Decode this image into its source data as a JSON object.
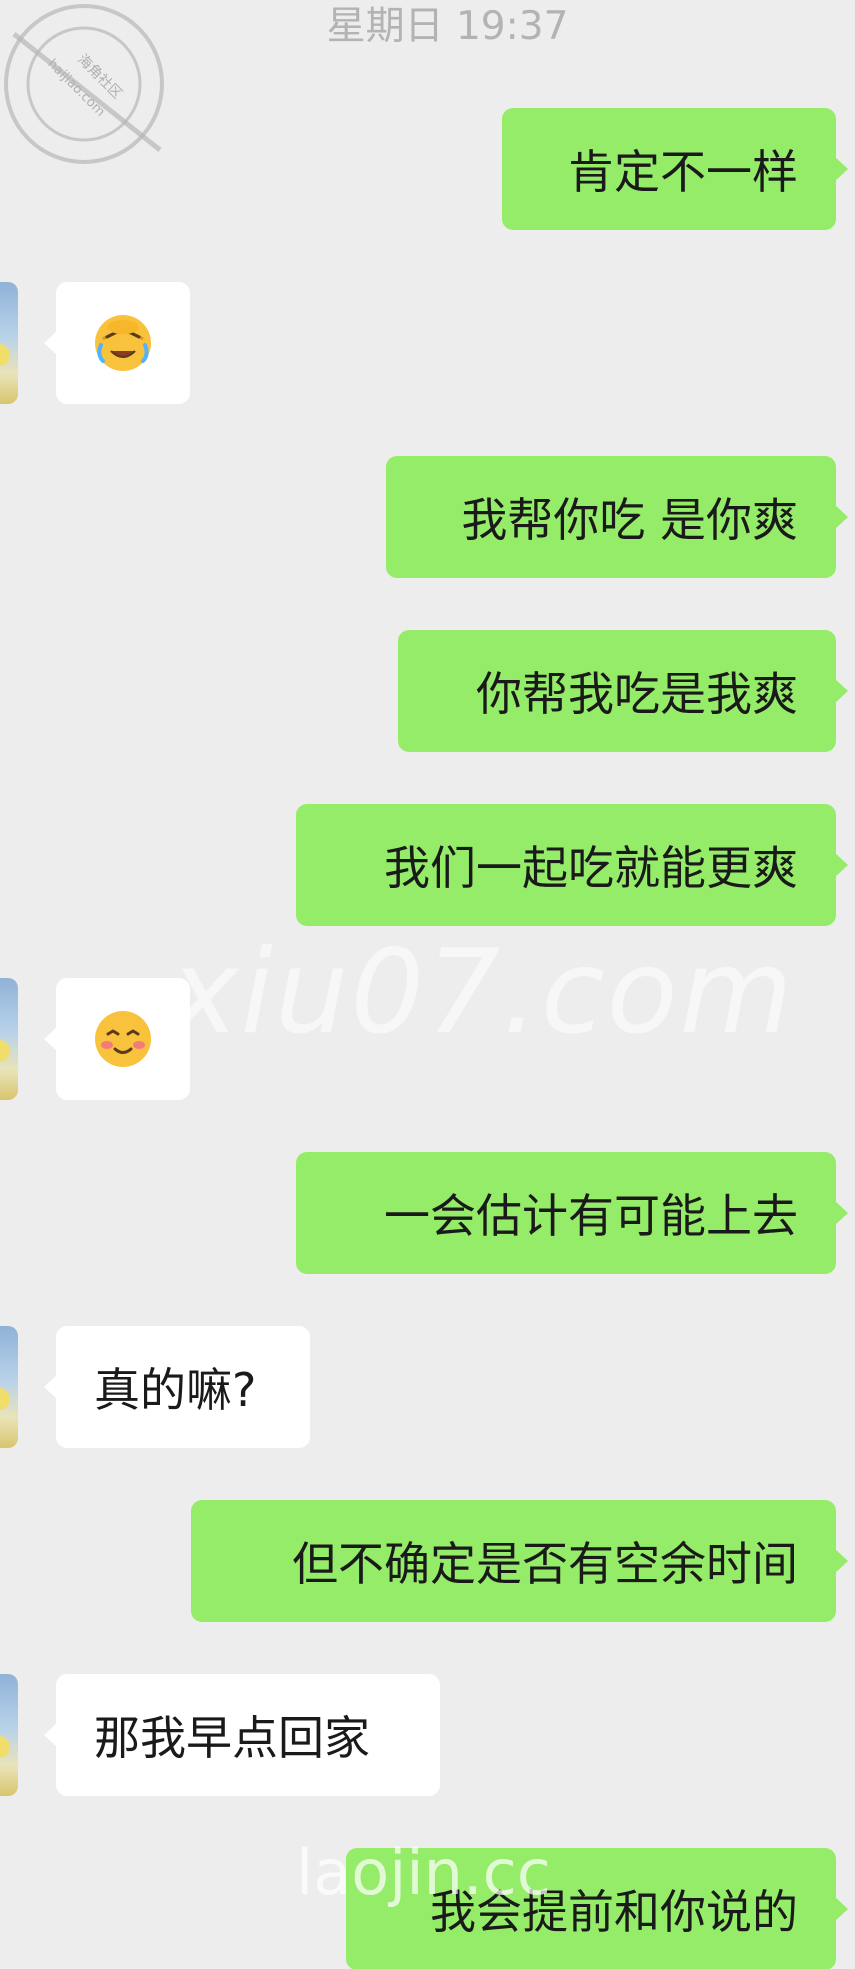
{
  "chat": {
    "timestamp": "星期日 19:37",
    "messages": [
      {
        "side": "out",
        "type": "text",
        "text": "肯定不一样"
      },
      {
        "side": "in",
        "type": "emoji",
        "emoji": "face-palm-tears-emoji"
      },
      {
        "side": "out",
        "type": "text",
        "text": "我帮你吃 是你爽"
      },
      {
        "side": "out",
        "type": "text",
        "text": "你帮我吃是我爽"
      },
      {
        "side": "out",
        "type": "text",
        "text": "我们一起吃就能更爽"
      },
      {
        "side": "in",
        "type": "emoji",
        "emoji": "blushing-smile-emoji"
      },
      {
        "side": "out",
        "type": "text",
        "text": "一会估计有可能上去"
      },
      {
        "side": "in",
        "type": "text",
        "text": "真的嘛?"
      },
      {
        "side": "out",
        "type": "text",
        "text": "但不确定是否有空余时间"
      },
      {
        "side": "in",
        "type": "text",
        "text": "那我早点回家"
      },
      {
        "side": "out",
        "type": "text",
        "text": "我会提前和你说的"
      }
    ]
  },
  "colors": {
    "background": "#ededed",
    "outgoing_bubble": "#95ec69",
    "incoming_bubble": "#ffffff",
    "timestamp_text": "#b3b3b3"
  },
  "watermarks": {
    "stamp_text_1": "海角社区",
    "stamp_text_2": "haijiao.com",
    "center": "xiu07.com",
    "bottom": "laojin.cc"
  }
}
